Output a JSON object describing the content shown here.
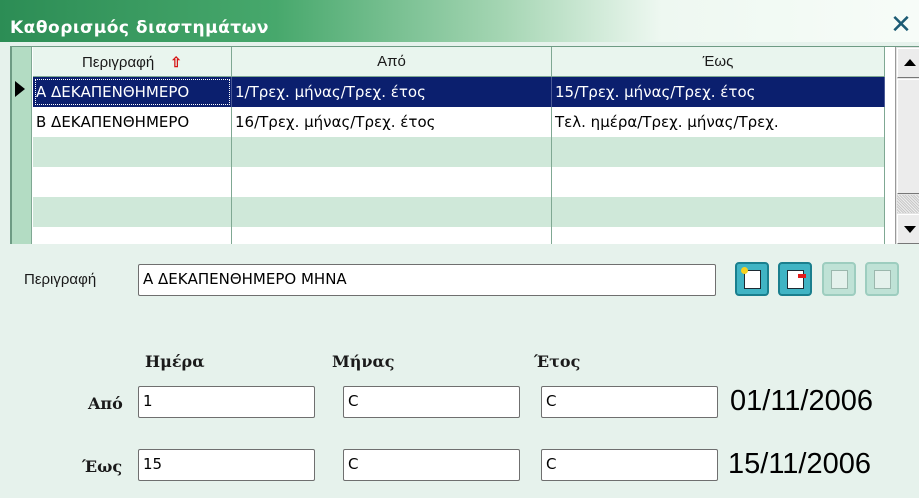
{
  "window": {
    "title": "Καθορισμός διαστημάτων",
    "close_icon": "close-icon"
  },
  "grid": {
    "columns": [
      "Περιγραφή",
      "Από",
      "Έως"
    ],
    "sort_icon": "sort-up-arrow-icon",
    "rows": [
      {
        "description": "Α ΔΕΚΑΠΕΝΘΗΜΕΡΟ",
        "from": "1/Τρεχ. μήνας/Τρεχ. έτος",
        "to": "15/Τρεχ. μήνας/Τρεχ. έτος",
        "selected": true
      },
      {
        "description": "Β ΔΕΚΑΠΕΝΘΗΜΕΡΟ",
        "from": "16/Τρεχ. μήνας/Τρεχ. έτος",
        "to": "Τελ. ημέρα/Τρεχ. μήνας/Τρεχ.",
        "selected": false
      }
    ]
  },
  "form": {
    "description_label": "Περιγραφή",
    "description_value": "Α ΔΕΚΑΠΕΝΘΗΜΕΡΟ ΜΗΝΑ",
    "day_header": "Ημέρα",
    "month_header": "Μήνας",
    "year_header": "Έτος",
    "from": {
      "label": "Από",
      "day": "1",
      "month": "C",
      "year": "C",
      "date": "01/11/2006"
    },
    "to": {
      "label": "Έως",
      "day": "15",
      "month": "C",
      "year": "C",
      "date": "15/11/2006"
    }
  },
  "toolbar": {
    "buttons": [
      {
        "icon": "new-record-icon",
        "enabled": true
      },
      {
        "icon": "delete-record-icon",
        "enabled": true
      },
      {
        "icon": "save-record-icon",
        "enabled": false
      },
      {
        "icon": "cancel-record-icon",
        "enabled": false
      }
    ]
  },
  "colors": {
    "selected_row": "#0b1f6e",
    "alt_row": "#cfe8d9",
    "background": "#e6f2ec",
    "title_gradient_start": "#2c8d55",
    "toolbar_active": "#40b4c4"
  }
}
